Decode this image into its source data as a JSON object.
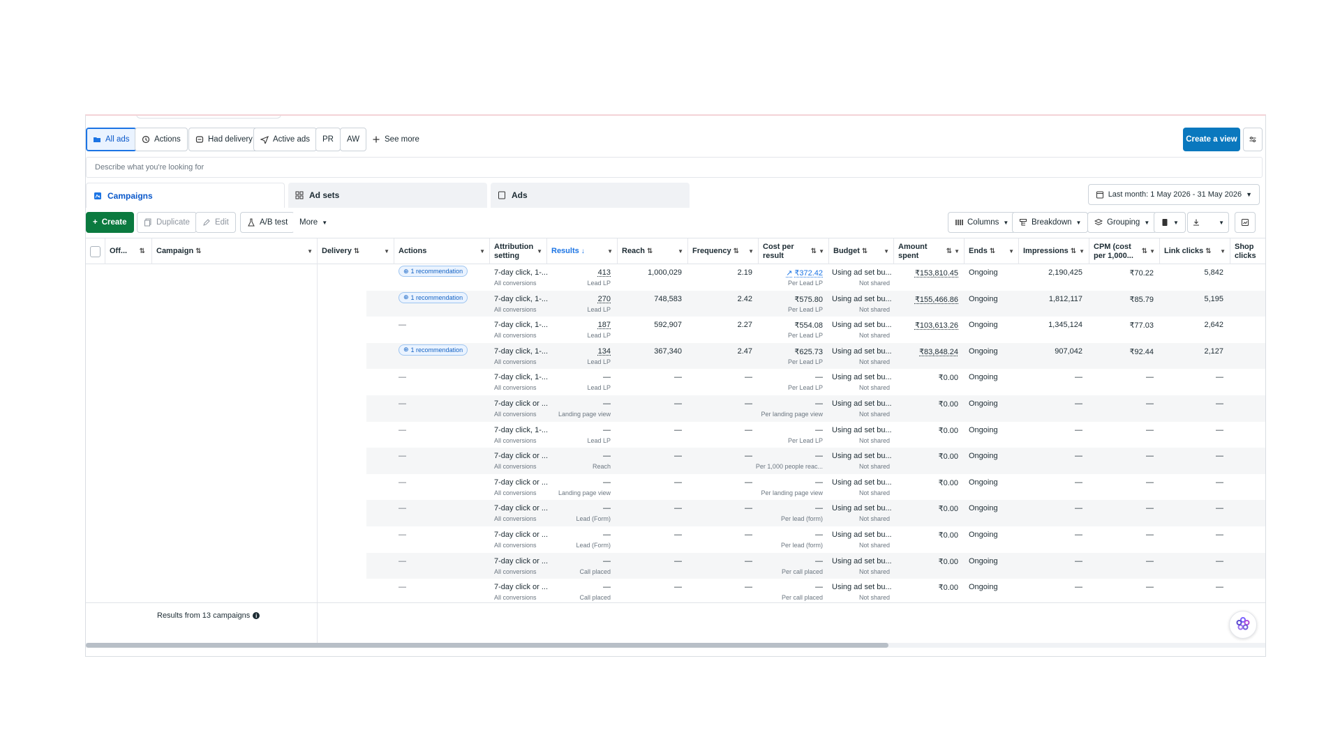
{
  "viewbar": {
    "items": [
      {
        "label": "All ads",
        "icon": "folder-icon"
      },
      {
        "label": "Actions",
        "icon": "actions-icon"
      },
      {
        "label": "Had delivery",
        "icon": "delivery-icon"
      },
      {
        "label": "Active ads",
        "icon": "send-icon"
      },
      {
        "label": "PR"
      },
      {
        "label": "AW"
      },
      {
        "label": "See more",
        "icon": "plus-icon"
      }
    ],
    "create_view": "Create a view"
  },
  "search": {
    "placeholder": "Describe what you're looking for"
  },
  "tabs": {
    "campaigns": "Campaigns",
    "adsets": "Ad sets",
    "ads": "Ads"
  },
  "date_range": "Last month: 1 May 2026 - 31 May 2026",
  "actions": {
    "create": "Create",
    "duplicate": "Duplicate",
    "edit": "Edit",
    "abtest": "A/B test",
    "more": "More",
    "columns": "Columns",
    "breakdown": "Breakdown",
    "grouping": "Grouping"
  },
  "headers": {
    "off": "Off...",
    "campaign": "Campaign",
    "delivery": "Delivery",
    "actions": "Actions",
    "attribution_1": "Attribution",
    "attribution_2": "setting",
    "results": "Results",
    "reach": "Reach",
    "frequency": "Frequency",
    "cpr_1": "Cost per",
    "cpr_2": "result",
    "budget": "Budget",
    "amount_1": "Amount",
    "amount_2": "spent",
    "ends": "Ends",
    "impressions": "Impressions",
    "cpm_1": "CPM (cost",
    "cpm_2": "per 1,000...",
    "link_clicks": "Link clicks",
    "shop_1": "Shop",
    "shop_2": "clicks"
  },
  "rows": [
    {
      "action": "1 recommendation",
      "attr": "7-day click, 1-...",
      "attr_sub": "All conversions",
      "results": "413",
      "results_sub": "Lead LP",
      "reach": "1,000,029",
      "freq": "2.19",
      "cpr": "₹372.42",
      "cpr_sub": "Per Lead LP",
      "trend": true,
      "budget": "Using ad set bu...",
      "budget_sub": "Not shared",
      "amount": "₹153,810.45",
      "ends": "Ongoing",
      "impr": "2,190,425",
      "cpm": "₹70.22",
      "link": "5,842"
    },
    {
      "action": "1 recommendation",
      "attr": "7-day click, 1-...",
      "attr_sub": "All conversions",
      "results": "270",
      "results_sub": "Lead LP",
      "reach": "748,583",
      "freq": "2.42",
      "cpr": "₹575.80",
      "cpr_sub": "Per Lead LP",
      "budget": "Using ad set bu...",
      "budget_sub": "Not shared",
      "amount": "₹155,466.86",
      "ends": "Ongoing",
      "impr": "1,812,117",
      "cpm": "₹85.79",
      "link": "5,195"
    },
    {
      "action": "—",
      "attr": "7-day click, 1-...",
      "attr_sub": "All conversions",
      "results": "187",
      "results_sub": "Lead LP",
      "reach": "592,907",
      "freq": "2.27",
      "cpr": "₹554.08",
      "cpr_sub": "Per Lead LP",
      "budget": "Using ad set bu...",
      "budget_sub": "Not shared",
      "amount": "₹103,613.26",
      "ends": "Ongoing",
      "impr": "1,345,124",
      "cpm": "₹77.03",
      "link": "2,642"
    },
    {
      "action": "1 recommendation",
      "attr": "7-day click, 1-...",
      "attr_sub": "All conversions",
      "results": "134",
      "results_sub": "Lead LP",
      "reach": "367,340",
      "freq": "2.47",
      "cpr": "₹625.73",
      "cpr_sub": "Per Lead LP",
      "budget": "Using ad set bu...",
      "budget_sub": "Not shared",
      "amount": "₹83,848.24",
      "ends": "Ongoing",
      "impr": "907,042",
      "cpm": "₹92.44",
      "link": "2,127"
    },
    {
      "action": "—",
      "attr": "7-day click, 1-...",
      "attr_sub": "All conversions",
      "results": "—",
      "results_sub": "Lead LP",
      "reach": "—",
      "freq": "—",
      "cpr": "—",
      "cpr_sub": "Per Lead LP",
      "budget": "Using ad set bu...",
      "budget_sub": "Not shared",
      "amount": "₹0.00",
      "ends": "Ongoing",
      "impr": "—",
      "cpm": "—",
      "link": "—"
    },
    {
      "action": "—",
      "attr": "7-day click or ...",
      "attr_sub": "All conversions",
      "results": "—",
      "results_sub": "Landing page view",
      "reach": "—",
      "freq": "—",
      "cpr": "—",
      "cpr_sub": "Per landing page view",
      "budget": "Using ad set bu...",
      "budget_sub": "Not shared",
      "amount": "₹0.00",
      "ends": "Ongoing",
      "impr": "—",
      "cpm": "—",
      "link": "—"
    },
    {
      "action": "—",
      "attr": "7-day click, 1-...",
      "attr_sub": "All conversions",
      "results": "—",
      "results_sub": "Lead LP",
      "reach": "—",
      "freq": "—",
      "cpr": "—",
      "cpr_sub": "Per Lead LP",
      "budget": "Using ad set bu...",
      "budget_sub": "Not shared",
      "amount": "₹0.00",
      "ends": "Ongoing",
      "impr": "—",
      "cpm": "—",
      "link": "—"
    },
    {
      "action": "—",
      "attr": "7-day click or ...",
      "attr_sub": "All conversions",
      "results": "—",
      "results_sub": "Reach",
      "reach": "—",
      "freq": "—",
      "cpr": "—",
      "cpr_sub": "Per 1,000 people reac...",
      "budget": "Using ad set bu...",
      "budget_sub": "Not shared",
      "amount": "₹0.00",
      "ends": "Ongoing",
      "impr": "—",
      "cpm": "—",
      "link": "—"
    },
    {
      "action": "—",
      "attr": "7-day click or ...",
      "attr_sub": "All conversions",
      "results": "—",
      "results_sub": "Landing page view",
      "reach": "—",
      "freq": "—",
      "cpr": "—",
      "cpr_sub": "Per landing page view",
      "budget": "Using ad set bu...",
      "budget_sub": "Not shared",
      "amount": "₹0.00",
      "ends": "Ongoing",
      "impr": "—",
      "cpm": "—",
      "link": "—"
    },
    {
      "action": "—",
      "attr": "7-day click or ...",
      "attr_sub": "All conversions",
      "results": "—",
      "results_sub": "Lead (Form)",
      "reach": "—",
      "freq": "—",
      "cpr": "—",
      "cpr_sub": "Per lead (form)",
      "budget": "Using ad set bu...",
      "budget_sub": "Not shared",
      "amount": "₹0.00",
      "ends": "Ongoing",
      "impr": "—",
      "cpm": "—",
      "link": "—"
    },
    {
      "action": "—",
      "attr": "7-day click or ...",
      "attr_sub": "All conversions",
      "results": "—",
      "results_sub": "Lead (Form)",
      "reach": "—",
      "freq": "—",
      "cpr": "—",
      "cpr_sub": "Per lead (form)",
      "budget": "Using ad set bu...",
      "budget_sub": "Not shared",
      "amount": "₹0.00",
      "ends": "Ongoing",
      "impr": "—",
      "cpm": "—",
      "link": "—"
    },
    {
      "action": "—",
      "attr": "7-day click or ...",
      "attr_sub": "All conversions",
      "results": "—",
      "results_sub": "Call placed",
      "reach": "—",
      "freq": "—",
      "cpr": "—",
      "cpr_sub": "Per call placed",
      "budget": "Using ad set bu...",
      "budget_sub": "Not shared",
      "amount": "₹0.00",
      "ends": "Ongoing",
      "impr": "—",
      "cpm": "—",
      "link": "—"
    },
    {
      "action": "—",
      "attr": "7-day click or ...",
      "attr_sub": "All conversions",
      "results": "—",
      "results_sub": "Call placed",
      "reach": "—",
      "freq": "—",
      "cpr": "—",
      "cpr_sub": "Per call placed",
      "budget": "Using ad set bu...",
      "budget_sub": "Not shared",
      "amount": "₹0.00",
      "ends": "Ongoing",
      "impr": "—",
      "cpm": "—",
      "link": "—"
    }
  ],
  "footer": {
    "summary": "Results from 13 campaigns"
  },
  "colors": {
    "accent": "#1b74e4",
    "create_green": "#0b7a3f",
    "create_view_blue": "#0a78be"
  }
}
